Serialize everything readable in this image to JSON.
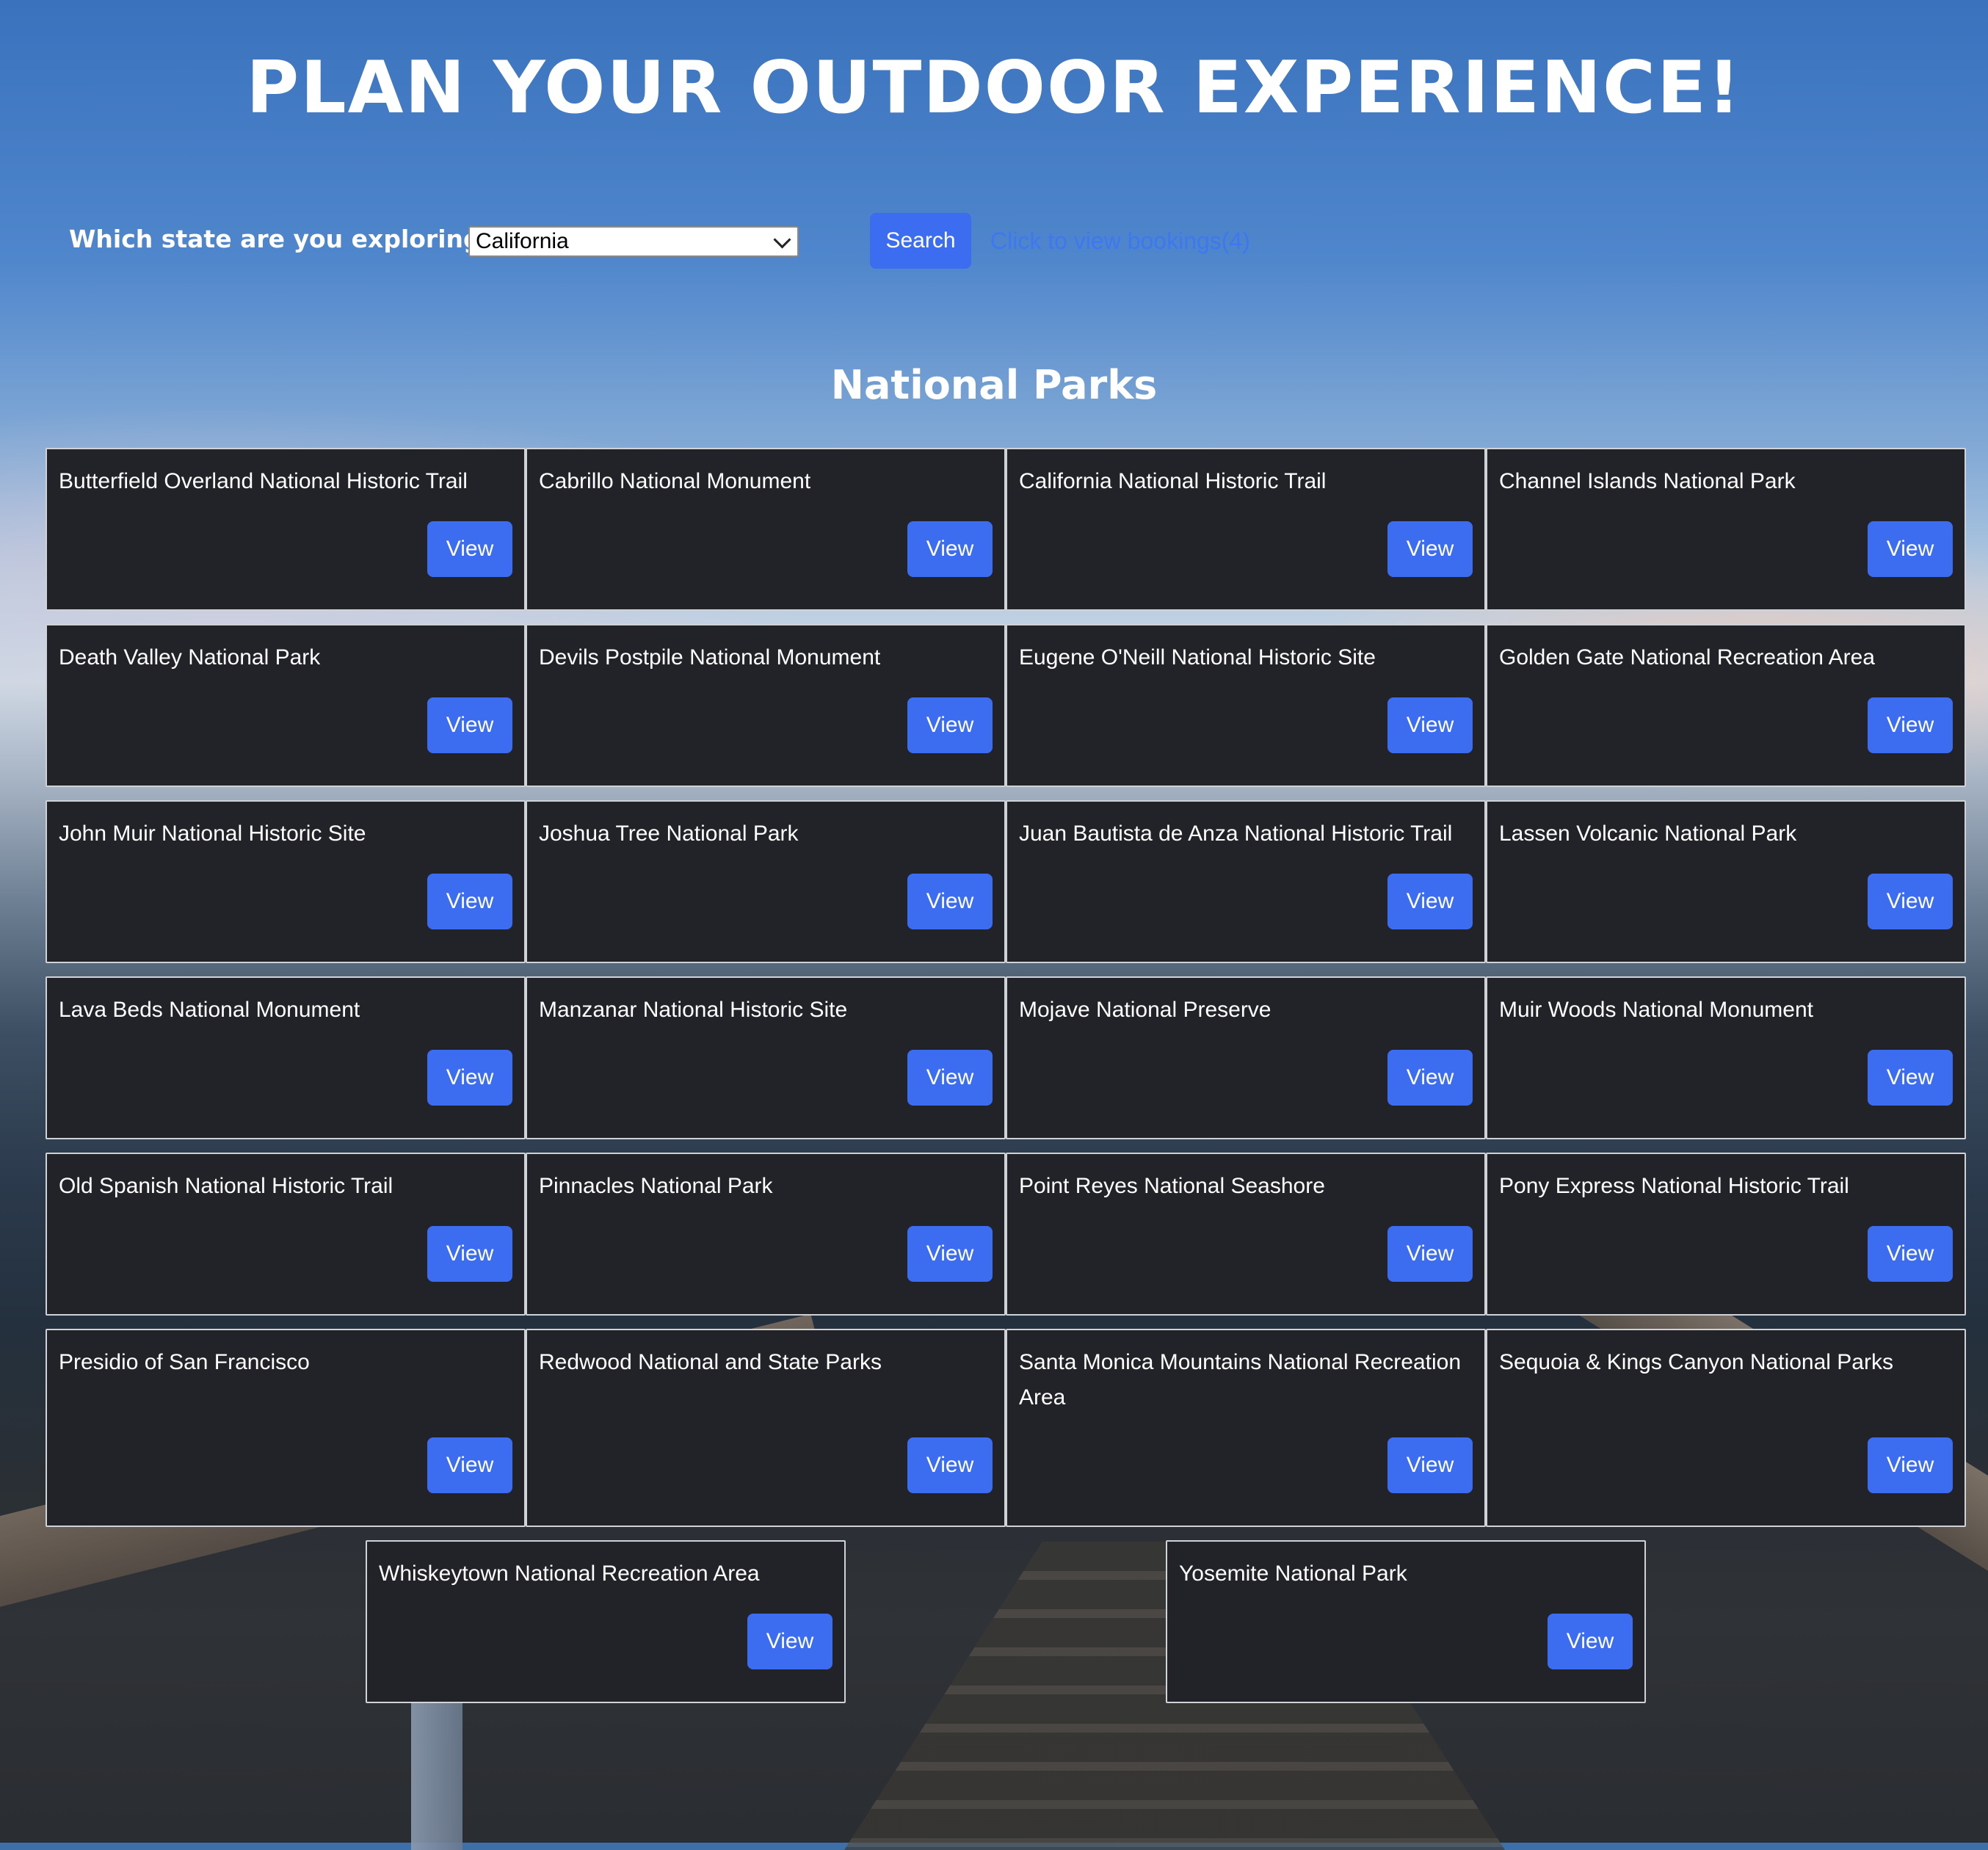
{
  "header": {
    "title": "PLAN YOUR OUTDOOR EXPERIENCE!"
  },
  "search": {
    "state_label": "Which state are you exploring?",
    "selected_state": "California",
    "search_label": "Search",
    "bookings_link": "Click to view bookings(4)"
  },
  "parks_section": {
    "title": "National Parks",
    "view_label": "View",
    "parks": [
      "Butterfield Overland National Historic Trail",
      "Cabrillo National Monument",
      "California National Historic Trail",
      "Channel Islands National Park",
      "Death Valley National Park",
      "Devils Postpile National Monument",
      "Eugene O'Neill National Historic Site",
      "Golden Gate National Recreation Area",
      "John Muir National Historic Site",
      "Joshua Tree National Park",
      "Juan Bautista de Anza National Historic Trail",
      "Lassen Volcanic National Park",
      "Lava Beds National Monument",
      "Manzanar National Historic Site",
      "Mojave National Preserve",
      "Muir Woods National Monument",
      "Old Spanish National Historic Trail",
      "Pinnacles National Park",
      "Point Reyes National Seashore",
      "Pony Express National Historic Trail",
      "Presidio of San Francisco",
      "Redwood National and State Parks",
      "Santa Monica Mountains National Recreation Area",
      "Sequoia & Kings Canyon National Parks",
      "Whiskeytown National Recreation Area",
      "Yosemite National Park"
    ]
  },
  "colors": {
    "accent": "#3c6df0",
    "card_background": "#212328",
    "link": "#3d78f2"
  }
}
